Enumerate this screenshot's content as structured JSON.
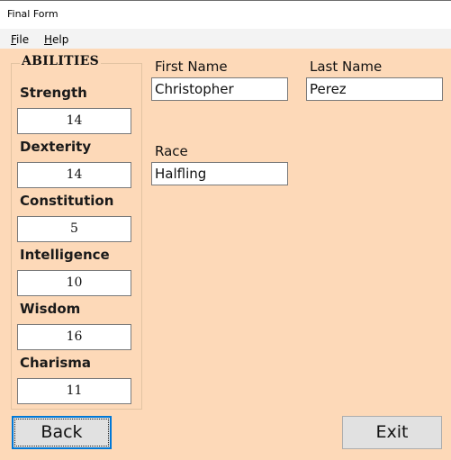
{
  "window": {
    "title": "Final Form"
  },
  "menu": [
    {
      "mnemonic": "F",
      "rest": "ile"
    },
    {
      "mnemonic": "H",
      "rest": "elp"
    }
  ],
  "abilities": {
    "title": "ABILITIES",
    "items": [
      {
        "label": "Strength",
        "value": "14"
      },
      {
        "label": "Dexterity",
        "value": "14"
      },
      {
        "label": "Constitution",
        "value": "5"
      },
      {
        "label": "Intelligence",
        "value": "10"
      },
      {
        "label": "Wisdom",
        "value": "16"
      },
      {
        "label": "Charisma",
        "value": "11"
      }
    ]
  },
  "form": {
    "first_name_label": "First Name",
    "first_name_value": "Christopher",
    "last_name_label": "Last Name",
    "last_name_value": "Perez",
    "race_label": "Race",
    "race_value": "Halfling"
  },
  "buttons": {
    "back": "Back",
    "exit": "Exit"
  },
  "colors": {
    "background": "#fdd9b8",
    "focus": "#0078d7"
  }
}
